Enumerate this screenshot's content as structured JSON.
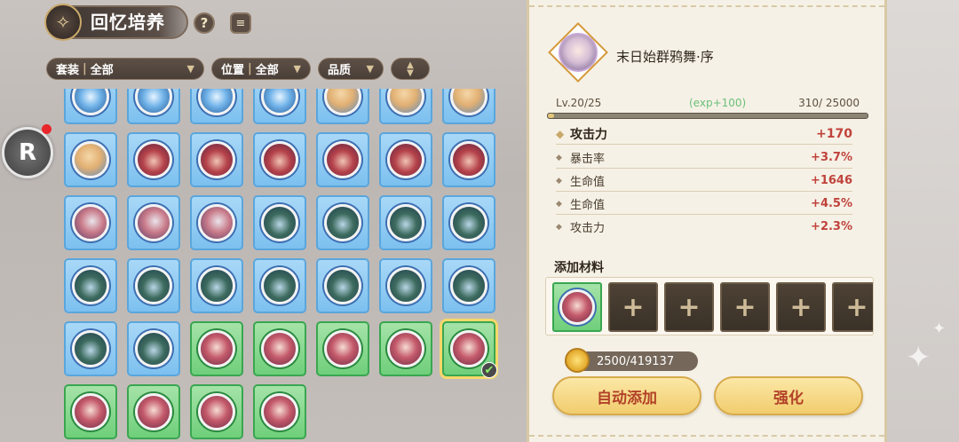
{
  "header": {
    "title": "回忆培养",
    "help_label": "?",
    "doc_label": "≡"
  },
  "filters": [
    {
      "name": "套装",
      "value": "全部"
    },
    {
      "name": "位置",
      "value": "全部"
    },
    {
      "name": "品质",
      "value": ""
    },
    {
      "name": "",
      "value": ""
    }
  ],
  "side_button": {
    "label": "R"
  },
  "grid": {
    "rows": [
      [
        "blue:p-blue",
        "blue:p-blue",
        "blue:p-blue",
        "blue:p-blue",
        "blue:p-blonde",
        "blue:p-blonde",
        "blue:p-blonde"
      ],
      [
        "blue:p-blonde",
        "blue:p-red",
        "blue:p-red",
        "blue:p-red",
        "blue:p-red",
        "blue:p-red",
        "blue:p-red"
      ],
      [
        "blue:p-white",
        "blue:p-white",
        "blue:p-white",
        "blue:p-tree",
        "blue:p-tree",
        "blue:p-tree",
        "blue:p-tree"
      ],
      [
        "blue:p-tree",
        "blue:p-tree",
        "blue:p-tree",
        "blue:p-tree",
        "blue:p-tree",
        "blue:p-tree",
        "blue:p-tree"
      ],
      [
        "blue:p-tree",
        "blue:p-tree",
        "green:p-pink",
        "green:p-pink",
        "green:p-pink",
        "green:p-pink",
        "green:p-pink:selected"
      ],
      [
        "green:p-pink",
        "green:p-pink",
        "green:p-pink",
        "green:p-pink"
      ]
    ]
  },
  "memory": {
    "name": "末日始群鸦舞·序",
    "level": "Lv.20/25",
    "exp_gain": "(exp+100)",
    "exp_progress": "310/ 25000",
    "exp_fraction": 0.0124
  },
  "stats": {
    "main": {
      "name": "攻击力",
      "value": "+170"
    },
    "subs": [
      {
        "name": "暴击率",
        "value": "+3.7%"
      },
      {
        "name": "生命值",
        "value": "+1646"
      },
      {
        "name": "生命值",
        "value": "+4.5%"
      },
      {
        "name": "攻击力",
        "value": "+2.3%"
      }
    ]
  },
  "materials": {
    "title": "添加材料",
    "slots": [
      "filled",
      "empty",
      "empty",
      "empty",
      "empty",
      "empty"
    ],
    "empty_label": "+"
  },
  "currency": {
    "value": "2500/419137"
  },
  "actions": {
    "auto_add": "自动添加",
    "enhance": "强化"
  }
}
